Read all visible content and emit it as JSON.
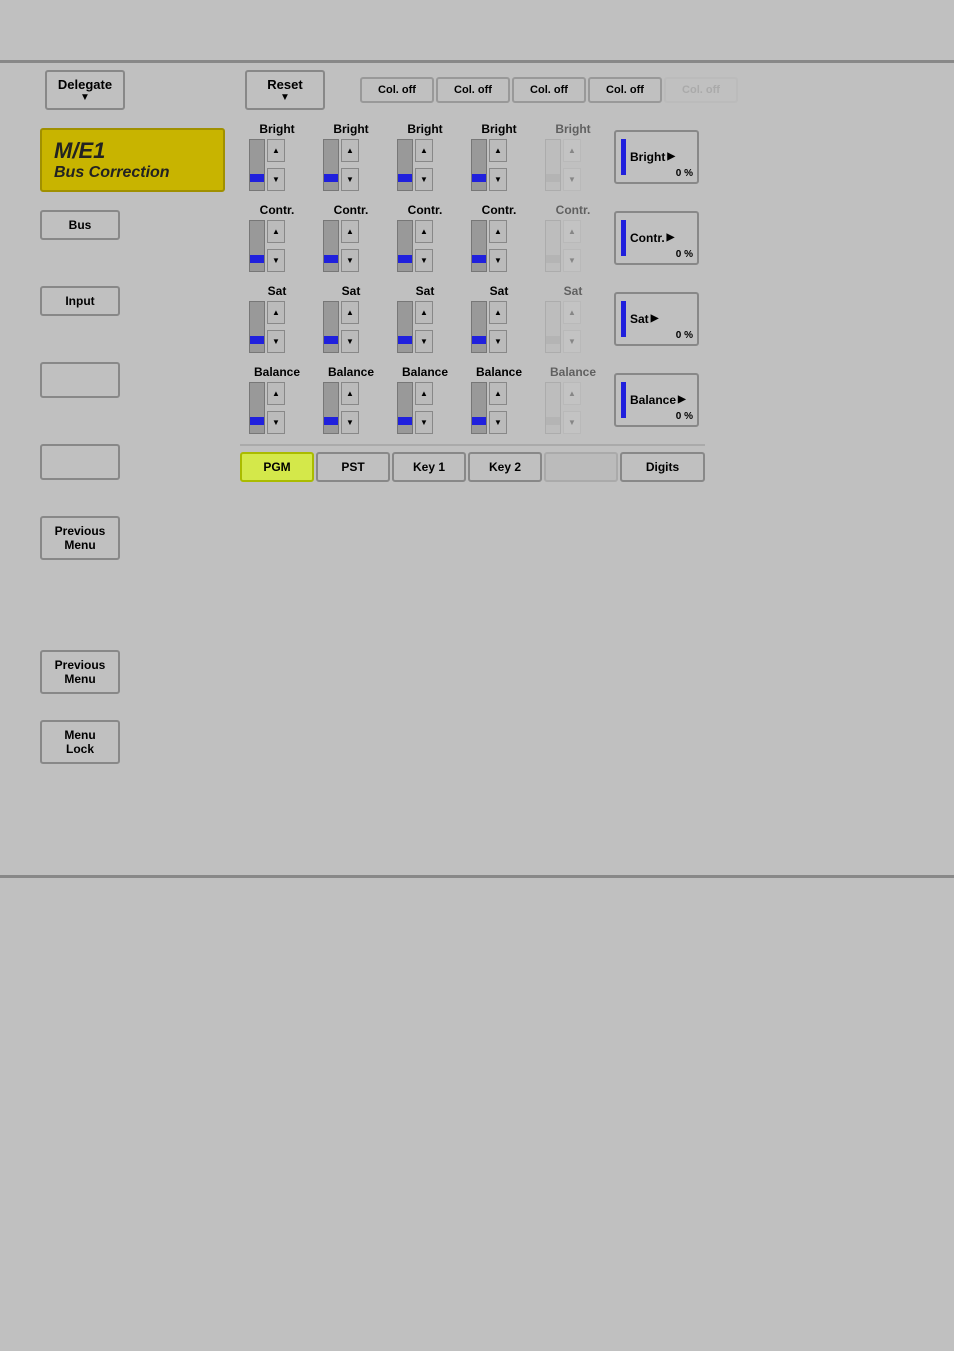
{
  "topLine": true,
  "bottomLine": true,
  "header": {
    "delegate_label": "Delegate",
    "delegate_arrow": "▼",
    "reset_label": "Reset",
    "reset_arrow": "▼",
    "col_off_buttons": [
      {
        "label": "Col. off",
        "active": true
      },
      {
        "label": "Col. off",
        "active": true
      },
      {
        "label": "Col. off",
        "active": true
      },
      {
        "label": "Col. off",
        "active": true
      },
      {
        "label": "Col. off",
        "active": false
      }
    ]
  },
  "title": {
    "me": "M/E1",
    "sub": "Bus Correction"
  },
  "sidebar": {
    "bus_label": "Bus",
    "input_label": "Input",
    "previous_menu_label": "Previous Menu",
    "menu_lock_label": "Menu Lock"
  },
  "sliders": {
    "sections": [
      {
        "id": "bright",
        "columns": [
          {
            "label": "Bright",
            "active": true
          },
          {
            "label": "Bright",
            "active": true
          },
          {
            "label": "Bright",
            "active": true
          },
          {
            "label": "Bright",
            "active": true
          },
          {
            "label": "Bright",
            "active": false
          }
        ]
      },
      {
        "id": "contr",
        "columns": [
          {
            "label": "Contr.",
            "active": true
          },
          {
            "label": "Contr.",
            "active": true
          },
          {
            "label": "Contr.",
            "active": true
          },
          {
            "label": "Contr.",
            "active": true
          },
          {
            "label": "Contr.",
            "active": false
          }
        ]
      },
      {
        "id": "sat",
        "columns": [
          {
            "label": "Sat",
            "active": true
          },
          {
            "label": "Sat",
            "active": true
          },
          {
            "label": "Sat",
            "active": true
          },
          {
            "label": "Sat",
            "active": true
          },
          {
            "label": "Sat",
            "active": false
          }
        ]
      },
      {
        "id": "balance",
        "columns": [
          {
            "label": "Balance",
            "active": true
          },
          {
            "label": "Balance",
            "active": true
          },
          {
            "label": "Balance",
            "active": true
          },
          {
            "label": "Balance",
            "active": true
          },
          {
            "label": "Balance",
            "active": false
          }
        ]
      }
    ]
  },
  "right_buttons": [
    {
      "id": "bright",
      "label": "Bright",
      "pct": "0 %"
    },
    {
      "id": "contr",
      "label": "Contr.",
      "pct": "0 %"
    },
    {
      "id": "sat",
      "label": "Sat",
      "pct": "0 %"
    },
    {
      "id": "balance",
      "label": "Balance",
      "pct": "0 %"
    }
  ],
  "bottom_buttons": [
    {
      "id": "pgm",
      "label": "PGM",
      "style": "pgm"
    },
    {
      "id": "pst",
      "label": "PST",
      "style": "normal"
    },
    {
      "id": "key1",
      "label": "Key 1",
      "style": "normal"
    },
    {
      "id": "key2",
      "label": "Key 2",
      "style": "normal"
    },
    {
      "id": "empty",
      "label": "",
      "style": "disabled"
    },
    {
      "id": "digits",
      "label": "Digits",
      "style": "normal"
    }
  ]
}
